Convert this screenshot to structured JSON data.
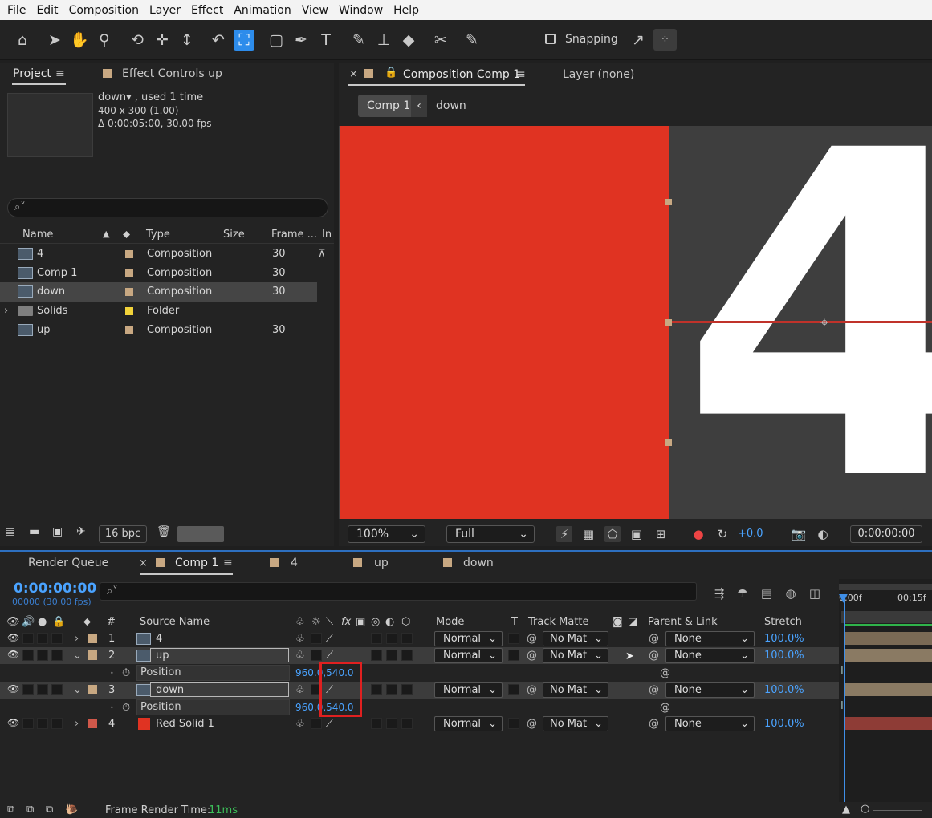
{
  "menu": [
    "File",
    "Edit",
    "Composition",
    "Layer",
    "Effect",
    "Animation",
    "View",
    "Window",
    "Help"
  ],
  "toolbar": {
    "snapping_label": "Snapping"
  },
  "project_panel": {
    "tab_project": "Project",
    "tab_effect_controls": "Effect Controls up",
    "info_name": "down▾ , used 1 time",
    "info_size": "400 x 300 (1.00)",
    "info_duration": "Δ 0:00:05:00, 30.00 fps",
    "search_placeholder": "⌕˅",
    "columns": {
      "name": "Name",
      "type": "Type",
      "size": "Size",
      "frame": "Frame ...",
      "in": "In"
    },
    "items": [
      {
        "name": "4",
        "type": "Composition",
        "frame": "30",
        "label_color": "#c8a882"
      },
      {
        "name": "Comp 1",
        "type": "Composition",
        "frame": "30",
        "label_color": "#c8a882"
      },
      {
        "name": "down",
        "type": "Composition",
        "frame": "30",
        "label_color": "#c8a882"
      },
      {
        "name": "Solids",
        "type": "Folder",
        "frame": "",
        "label_color": "#f2d33a"
      },
      {
        "name": "up",
        "type": "Composition",
        "frame": "30",
        "label_color": "#c8a882"
      }
    ],
    "bpc": "16 bpc"
  },
  "comp_viewer": {
    "tab_label": "Composition Comp 1",
    "layer_tab": "Layer (none)",
    "breadcrumb_active": "Comp 1",
    "breadcrumb_next": "down",
    "big_number": "4",
    "zoom": "100%",
    "resolution": "Full",
    "exposure": "+0.0",
    "timecode": "0:00:00:00"
  },
  "timeline": {
    "tabs": {
      "render_queue": "Render Queue",
      "comp1": "Comp 1",
      "t4": "4",
      "up": "up",
      "down": "down"
    },
    "time": "0:00:00:00",
    "frames": "00000 (30.00 fps)",
    "search_placeholder": "⌕˅",
    "columns": {
      "num": "#",
      "source": "Source Name",
      "mode": "Mode",
      "t": "T",
      "track_matte": "Track Matte",
      "parent": "Parent & Link",
      "stretch": "Stretch"
    },
    "ruler": {
      "start": "0:00f",
      "mark": "00:15f"
    },
    "layers": [
      {
        "num": "1",
        "name": "4",
        "mode": "Normal",
        "matte": "No Mat",
        "parent": "None",
        "stretch": "100.0%"
      },
      {
        "num": "2",
        "name": "up",
        "mode": "Normal",
        "matte": "No Mat",
        "parent": "None",
        "stretch": "100.0%"
      },
      {
        "num": "3",
        "name": "down",
        "mode": "Normal",
        "matte": "No Mat",
        "parent": "None",
        "stretch": "100.0%"
      },
      {
        "num": "4",
        "name": "Red Solid 1",
        "mode": "Normal",
        "matte": "No Mat",
        "parent": "None",
        "stretch": "100.0%"
      }
    ],
    "position_label": "Position",
    "position_value": "960.0,540.0",
    "footer_label": "Frame Render Time:",
    "footer_value": "11ms"
  }
}
